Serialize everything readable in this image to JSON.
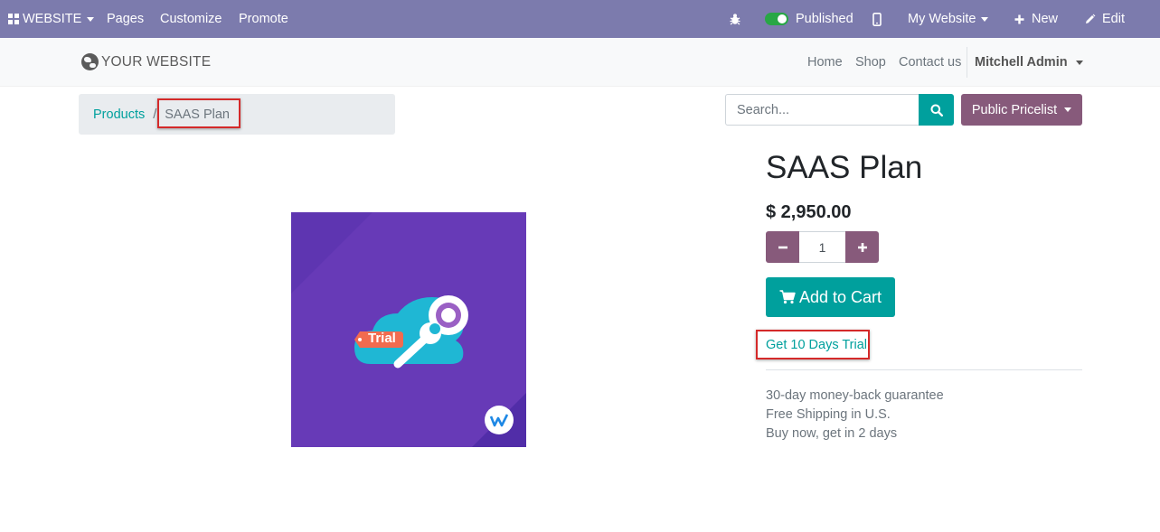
{
  "adminbar": {
    "website_label": "WEBSITE",
    "pages_label": "Pages",
    "customize_label": "Customize",
    "promote_label": "Promote",
    "published_label": "Published",
    "mywebsite_label": "My Website",
    "new_label": "New",
    "edit_label": "Edit",
    "published_toggle_on": true
  },
  "header": {
    "logo_text": "YOUR WEBSITE",
    "nav": [
      "Home",
      "Shop",
      "Contact us"
    ],
    "user_label": "Mitchell Admin"
  },
  "breadcrumb": {
    "products_label": "Products",
    "separator": "/",
    "current_label": "SAAS Plan"
  },
  "search": {
    "placeholder": "Search..."
  },
  "pricelist": {
    "label": "Public Pricelist"
  },
  "product": {
    "title": "SAAS Plan",
    "price": "$ 2,950.00",
    "quantity": "1",
    "add_to_cart_label": "Add to Cart",
    "trial_link": "Get 10 Days Trial",
    "image_badge_text": "Trial",
    "terms": [
      "30-day money-back guarantee",
      "Free Shipping in U.S.",
      "Buy now, get in 2 days"
    ]
  },
  "colors": {
    "admin_bar": "#7c7bad",
    "primary": "#00a09d",
    "secondary": "#875a7b",
    "product_bg": "#673ab7",
    "highlight": "#d42a2a"
  }
}
